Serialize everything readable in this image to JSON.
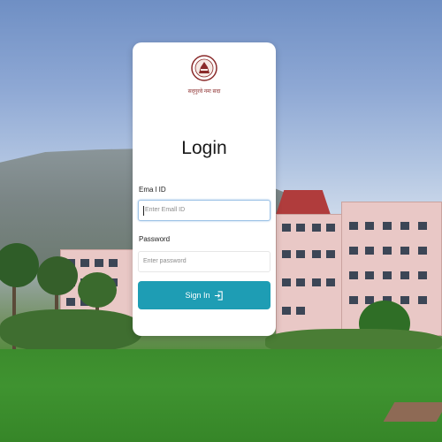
{
  "colors": {
    "button_bg": "#1e9db4",
    "card_bg": "#ffffff",
    "emblem": "#8a2a2a",
    "focus_border": "#9ec3e6"
  },
  "logo": {
    "icon": "university-emblem-icon",
    "motto": "सद्‌गुरवे नमः सदा"
  },
  "login": {
    "title": "Login",
    "email": {
      "label": "Ema l ID",
      "placeholder": "Enter Emall ID"
    },
    "password": {
      "label": "Password",
      "placeholder": "Enter password"
    },
    "submit": {
      "label": "Sign In",
      "icon": "sign-in-icon"
    }
  }
}
